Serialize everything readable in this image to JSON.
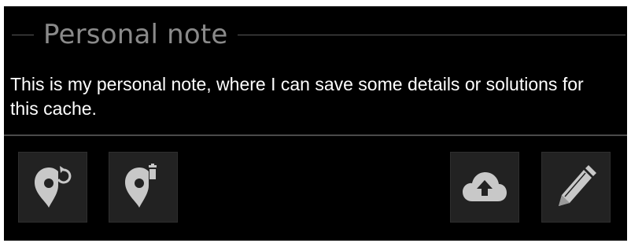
{
  "section": {
    "title": "Personal note"
  },
  "note": {
    "text": "This is my personal note, where I can save some details or solutions for this cache."
  },
  "actions": [
    {
      "id": "refresh",
      "icon": "marker-refresh-icon"
    },
    {
      "id": "delete",
      "icon": "marker-delete-icon"
    },
    {
      "id": "upload",
      "icon": "cloud-upload-icon"
    },
    {
      "id": "edit",
      "icon": "pencil-icon"
    }
  ],
  "colors": {
    "background": "#000000",
    "button_bg": "#222222",
    "icon": "#c8c8c8",
    "header_text": "#8a8a8a",
    "body_text": "#ffffff"
  }
}
